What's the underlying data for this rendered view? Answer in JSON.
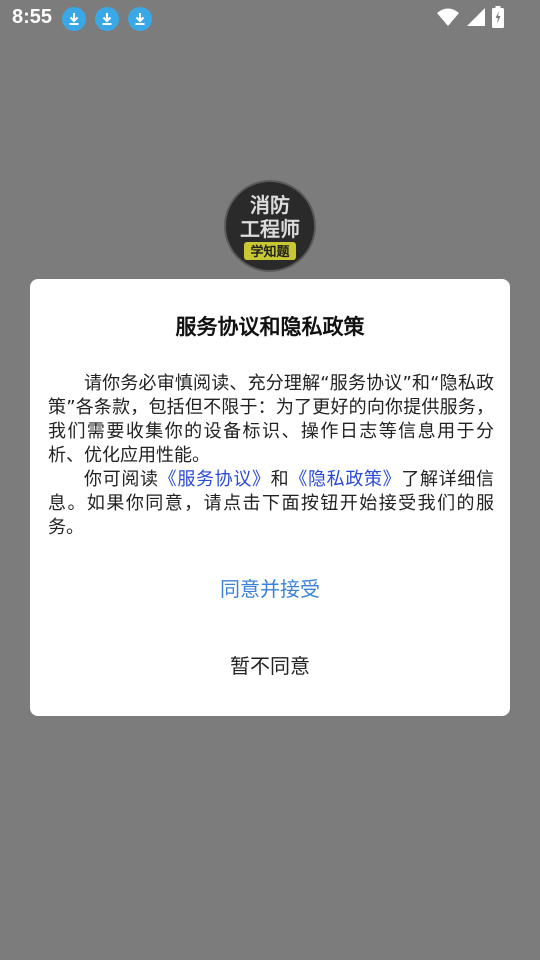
{
  "status_bar": {
    "time": "8:55",
    "notifications": [
      "download-icon",
      "download-icon",
      "download-icon"
    ],
    "wifi": "wifi-icon",
    "signal": "signal-icon",
    "battery": "battery-charging-icon"
  },
  "app_logo": {
    "line1": "消防",
    "line2": "工程师",
    "line3": "学知题"
  },
  "dialog": {
    "title": "服务协议和隐私政策",
    "paragraph1": "请你务必审慎阅读、充分理解“服务协议”和“隐私政策”各条款，包括但不限于：为了更好的向你提供服务，我们需要收集你的设备标识、操作日志等信息用于分析、优化应用性能。",
    "p2_prefix": "你可阅读",
    "p2_link1": "《服务协议》",
    "p2_middle": "和",
    "p2_link2": "《隐私政策》",
    "p2_suffix": "了解详细信息。如果你同意，请点击下面按钮开始接受我们的服务。",
    "agree_label": "同意并接受",
    "decline_label": "暂不同意"
  },
  "colors": {
    "overlay": "#7c7c7c",
    "link": "#2a4bd7",
    "agree": "#3b82d8",
    "download_badge": "#3aa8e6"
  }
}
